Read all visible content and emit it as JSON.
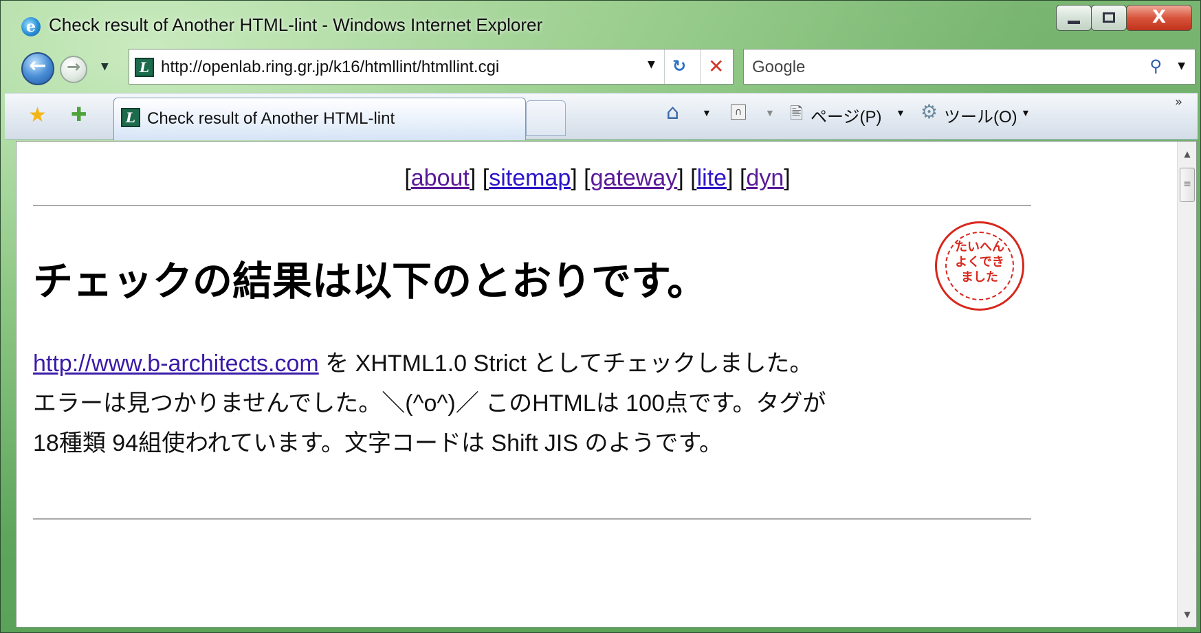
{
  "window": {
    "title": "Check result of Another HTML-lint - Windows Internet Explorer",
    "minimize_glyph": "",
    "maximize_glyph": "",
    "close_glyph": "X"
  },
  "address_bar": {
    "url": "http://openlab.ring.gr.jp/k16/htmllint/htmllint.cgi"
  },
  "search": {
    "placeholder": "Google"
  },
  "tab": {
    "label": "Check result of Another HTML-lint"
  },
  "command_bar": {
    "page_label": "ページ(P)",
    "tools_label": "ツール(O)"
  },
  "nav_links": [
    {
      "label": "about"
    },
    {
      "label": "sitemap"
    },
    {
      "label": "gateway"
    },
    {
      "label": "lite"
    },
    {
      "label": "dyn"
    }
  ],
  "heading": "チェックの結果は以下のとおりです。",
  "stamp_text": "たいへんよくできました",
  "result": {
    "link": "http://www.b-architects.com",
    "text_1": " を XHTML1.0 Strict としてチェックしました。",
    "text_2": "エラーは見つかりませんでした。＼(^o^)／ このHTMLは 100点です。タグが",
    "text_3": "18種類 94組使われています。文字コードは Shift JIS のようです。"
  },
  "colors": {
    "link": "#2a15c9",
    "visited_link": "#5a1a99",
    "stamp": "#d8271c"
  },
  "icons": [
    "ie-icon",
    "back-icon",
    "forward-icon",
    "page-icon",
    "refresh-icon",
    "stop-icon",
    "search-icon",
    "favorites-star-icon",
    "add-favorites-icon",
    "home-icon",
    "feed-icon",
    "page-menu-icon",
    "gear-icon",
    "chevron-icon"
  ]
}
